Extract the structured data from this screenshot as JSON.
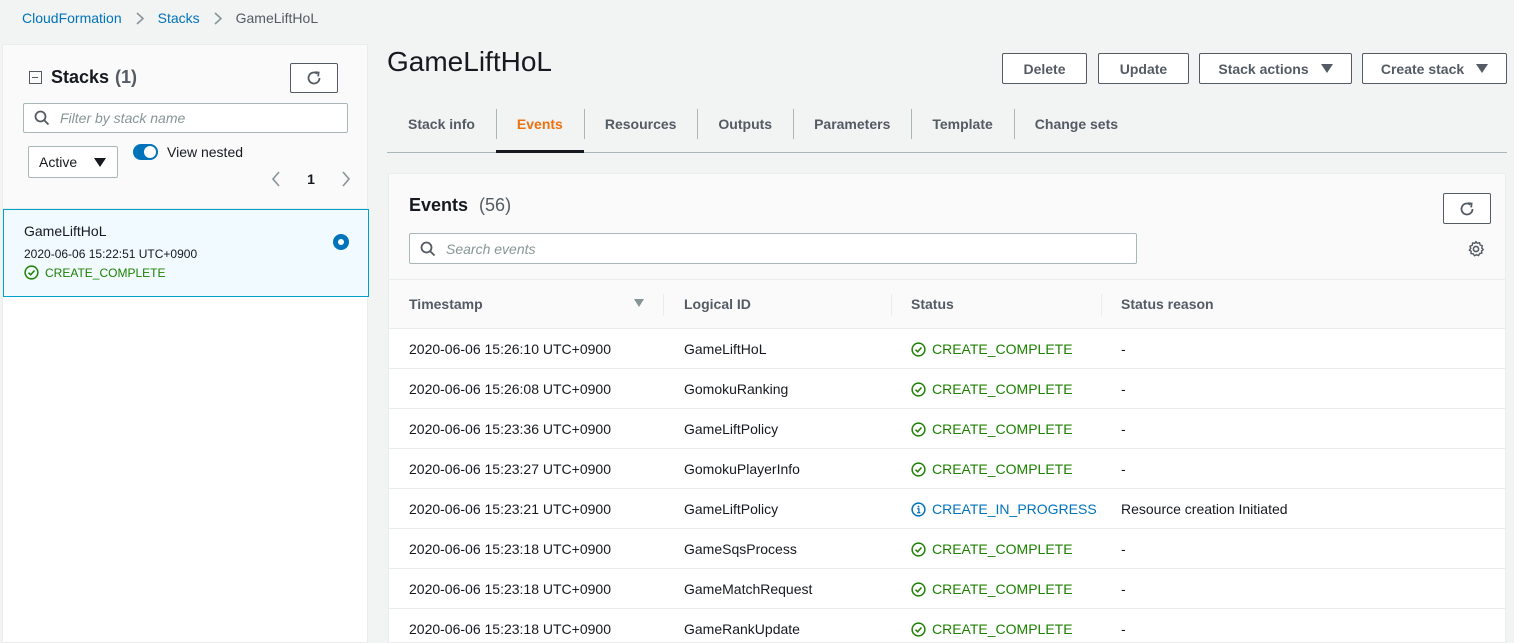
{
  "breadcrumb": {
    "items": [
      "CloudFormation",
      "Stacks"
    ],
    "current": "GameLiftHoL"
  },
  "sidebar": {
    "title": "Stacks",
    "count": "(1)",
    "filter_placeholder": "Filter by stack name",
    "status_filter": "Active",
    "view_nested_label": "View nested",
    "view_nested_on": true,
    "page": "1",
    "stacks": [
      {
        "name": "GameLiftHoL",
        "created": "2020-06-06 15:22:51 UTC+0900",
        "status": "CREATE_COMPLETE",
        "selected": true
      }
    ]
  },
  "stack": {
    "title": "GameLiftHoL",
    "buttons": {
      "delete": "Delete",
      "update": "Update",
      "stack_actions": "Stack actions",
      "create_stack": "Create stack"
    }
  },
  "tabs": [
    "Stack info",
    "Events",
    "Resources",
    "Outputs",
    "Parameters",
    "Template",
    "Change sets"
  ],
  "active_tab": "Events",
  "events": {
    "title": "Events",
    "count": "(56)",
    "search_placeholder": "Search events",
    "columns": [
      "Timestamp",
      "Logical ID",
      "Status",
      "Status reason"
    ],
    "rows": [
      {
        "timestamp": "2020-06-06 15:26:10 UTC+0900",
        "logical_id": "GameLiftHoL",
        "status": "CREATE_COMPLETE",
        "reason": "-"
      },
      {
        "timestamp": "2020-06-06 15:26:08 UTC+0900",
        "logical_id": "GomokuRanking",
        "status": "CREATE_COMPLETE",
        "reason": "-"
      },
      {
        "timestamp": "2020-06-06 15:23:36 UTC+0900",
        "logical_id": "GameLiftPolicy",
        "status": "CREATE_COMPLETE",
        "reason": "-"
      },
      {
        "timestamp": "2020-06-06 15:23:27 UTC+0900",
        "logical_id": "GomokuPlayerInfo",
        "status": "CREATE_COMPLETE",
        "reason": "-"
      },
      {
        "timestamp": "2020-06-06 15:23:21 UTC+0900",
        "logical_id": "GameLiftPolicy",
        "status": "CREATE_IN_PROGRESS",
        "reason": "Resource creation Initiated"
      },
      {
        "timestamp": "2020-06-06 15:23:18 UTC+0900",
        "logical_id": "GameSqsProcess",
        "status": "CREATE_COMPLETE",
        "reason": "-"
      },
      {
        "timestamp": "2020-06-06 15:23:18 UTC+0900",
        "logical_id": "GameMatchRequest",
        "status": "CREATE_COMPLETE",
        "reason": "-"
      },
      {
        "timestamp": "2020-06-06 15:23:18 UTC+0900",
        "logical_id": "GameRankUpdate",
        "status": "CREATE_COMPLETE",
        "reason": "-"
      }
    ]
  },
  "colors": {
    "link": "#0073bb",
    "success": "#1d8102",
    "active_tab": "#ec7211",
    "selected_bg": "#f1faff"
  }
}
